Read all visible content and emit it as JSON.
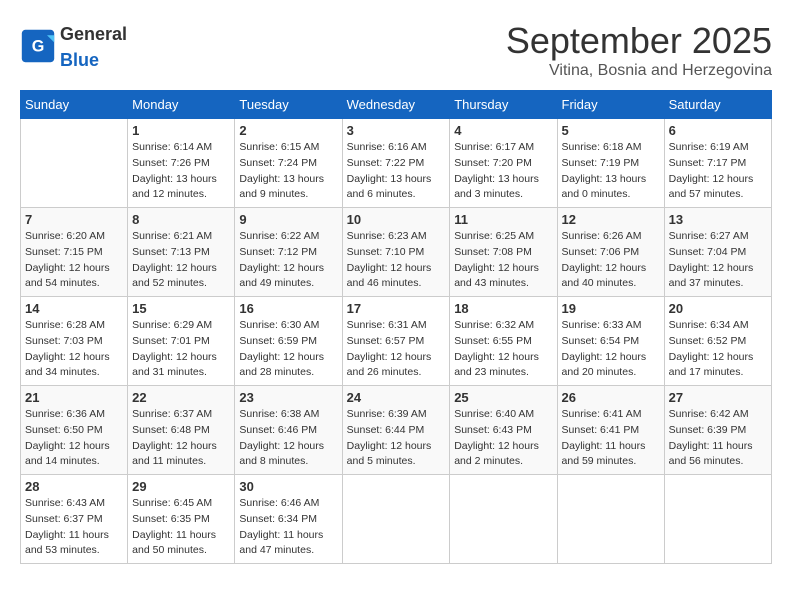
{
  "header": {
    "logo_general": "General",
    "logo_blue": "Blue",
    "month_title": "September 2025",
    "subtitle": "Vitina, Bosnia and Herzegovina"
  },
  "weekdays": [
    "Sunday",
    "Monday",
    "Tuesday",
    "Wednesday",
    "Thursday",
    "Friday",
    "Saturday"
  ],
  "weeks": [
    [
      {
        "day": "",
        "info": ""
      },
      {
        "day": "1",
        "info": "Sunrise: 6:14 AM\nSunset: 7:26 PM\nDaylight: 13 hours\nand 12 minutes."
      },
      {
        "day": "2",
        "info": "Sunrise: 6:15 AM\nSunset: 7:24 PM\nDaylight: 13 hours\nand 9 minutes."
      },
      {
        "day": "3",
        "info": "Sunrise: 6:16 AM\nSunset: 7:22 PM\nDaylight: 13 hours\nand 6 minutes."
      },
      {
        "day": "4",
        "info": "Sunrise: 6:17 AM\nSunset: 7:20 PM\nDaylight: 13 hours\nand 3 minutes."
      },
      {
        "day": "5",
        "info": "Sunrise: 6:18 AM\nSunset: 7:19 PM\nDaylight: 13 hours\nand 0 minutes."
      },
      {
        "day": "6",
        "info": "Sunrise: 6:19 AM\nSunset: 7:17 PM\nDaylight: 12 hours\nand 57 minutes."
      }
    ],
    [
      {
        "day": "7",
        "info": "Sunrise: 6:20 AM\nSunset: 7:15 PM\nDaylight: 12 hours\nand 54 minutes."
      },
      {
        "day": "8",
        "info": "Sunrise: 6:21 AM\nSunset: 7:13 PM\nDaylight: 12 hours\nand 52 minutes."
      },
      {
        "day": "9",
        "info": "Sunrise: 6:22 AM\nSunset: 7:12 PM\nDaylight: 12 hours\nand 49 minutes."
      },
      {
        "day": "10",
        "info": "Sunrise: 6:23 AM\nSunset: 7:10 PM\nDaylight: 12 hours\nand 46 minutes."
      },
      {
        "day": "11",
        "info": "Sunrise: 6:25 AM\nSunset: 7:08 PM\nDaylight: 12 hours\nand 43 minutes."
      },
      {
        "day": "12",
        "info": "Sunrise: 6:26 AM\nSunset: 7:06 PM\nDaylight: 12 hours\nand 40 minutes."
      },
      {
        "day": "13",
        "info": "Sunrise: 6:27 AM\nSunset: 7:04 PM\nDaylight: 12 hours\nand 37 minutes."
      }
    ],
    [
      {
        "day": "14",
        "info": "Sunrise: 6:28 AM\nSunset: 7:03 PM\nDaylight: 12 hours\nand 34 minutes."
      },
      {
        "day": "15",
        "info": "Sunrise: 6:29 AM\nSunset: 7:01 PM\nDaylight: 12 hours\nand 31 minutes."
      },
      {
        "day": "16",
        "info": "Sunrise: 6:30 AM\nSunset: 6:59 PM\nDaylight: 12 hours\nand 28 minutes."
      },
      {
        "day": "17",
        "info": "Sunrise: 6:31 AM\nSunset: 6:57 PM\nDaylight: 12 hours\nand 26 minutes."
      },
      {
        "day": "18",
        "info": "Sunrise: 6:32 AM\nSunset: 6:55 PM\nDaylight: 12 hours\nand 23 minutes."
      },
      {
        "day": "19",
        "info": "Sunrise: 6:33 AM\nSunset: 6:54 PM\nDaylight: 12 hours\nand 20 minutes."
      },
      {
        "day": "20",
        "info": "Sunrise: 6:34 AM\nSunset: 6:52 PM\nDaylight: 12 hours\nand 17 minutes."
      }
    ],
    [
      {
        "day": "21",
        "info": "Sunrise: 6:36 AM\nSunset: 6:50 PM\nDaylight: 12 hours\nand 14 minutes."
      },
      {
        "day": "22",
        "info": "Sunrise: 6:37 AM\nSunset: 6:48 PM\nDaylight: 12 hours\nand 11 minutes."
      },
      {
        "day": "23",
        "info": "Sunrise: 6:38 AM\nSunset: 6:46 PM\nDaylight: 12 hours\nand 8 minutes."
      },
      {
        "day": "24",
        "info": "Sunrise: 6:39 AM\nSunset: 6:44 PM\nDaylight: 12 hours\nand 5 minutes."
      },
      {
        "day": "25",
        "info": "Sunrise: 6:40 AM\nSunset: 6:43 PM\nDaylight: 12 hours\nand 2 minutes."
      },
      {
        "day": "26",
        "info": "Sunrise: 6:41 AM\nSunset: 6:41 PM\nDaylight: 11 hours\nand 59 minutes."
      },
      {
        "day": "27",
        "info": "Sunrise: 6:42 AM\nSunset: 6:39 PM\nDaylight: 11 hours\nand 56 minutes."
      }
    ],
    [
      {
        "day": "28",
        "info": "Sunrise: 6:43 AM\nSunset: 6:37 PM\nDaylight: 11 hours\nand 53 minutes."
      },
      {
        "day": "29",
        "info": "Sunrise: 6:45 AM\nSunset: 6:35 PM\nDaylight: 11 hours\nand 50 minutes."
      },
      {
        "day": "30",
        "info": "Sunrise: 6:46 AM\nSunset: 6:34 PM\nDaylight: 11 hours\nand 47 minutes."
      },
      {
        "day": "",
        "info": ""
      },
      {
        "day": "",
        "info": ""
      },
      {
        "day": "",
        "info": ""
      },
      {
        "day": "",
        "info": ""
      }
    ]
  ]
}
